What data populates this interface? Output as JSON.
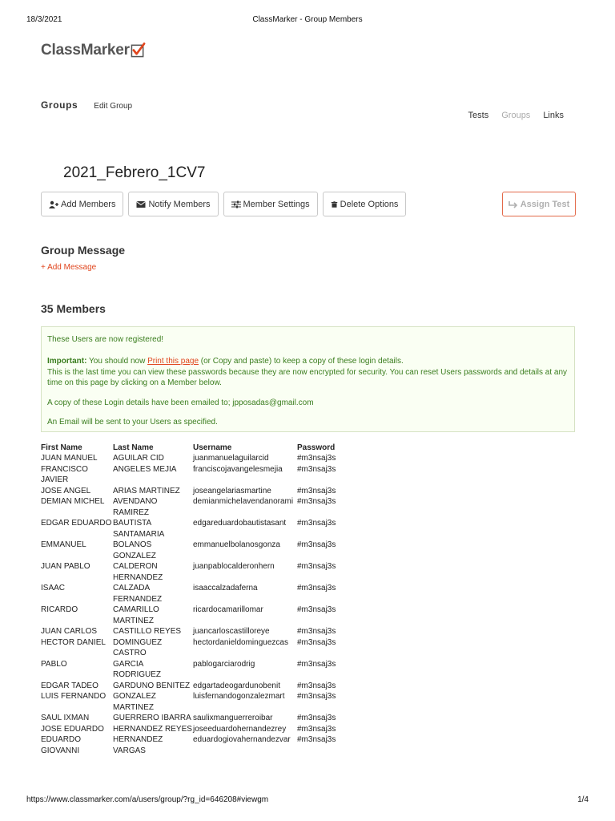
{
  "print_header": {
    "date": "18/3/2021",
    "title": "ClassMarker - Group Members"
  },
  "logo": {
    "text": "ClassMarker",
    "accent": "#e0451d"
  },
  "tabs": {
    "groups": "Groups",
    "edit_group": "Edit Group"
  },
  "topnav": {
    "tests": "Tests",
    "groups": "Groups",
    "links": "Links"
  },
  "group": {
    "title": "2021_Febrero_1CV7"
  },
  "toolbar": {
    "add_members": "Add Members",
    "notify_members": "Notify Members",
    "member_settings": "Member Settings",
    "delete_options": "Delete Options",
    "assign_test": "Assign Test"
  },
  "group_message": {
    "heading": "Group Message",
    "add_message": "+ Add Message"
  },
  "members_section": {
    "heading": "35 Members"
  },
  "notice": {
    "registered": "These Users are now registered!",
    "important_label": "Important:",
    "important_before": " You should now ",
    "print_link": "Print this page",
    "important_after": " (or Copy and paste) to keep a copy of these login details.",
    "last_time": "This is the last time you can view these passwords because they are now encrypted for security. You can reset Users passwords and details at any time on this page by clicking on a Member below.",
    "emailed": "A copy of these Login details have been emailed to; jpposadas@gmail.com",
    "email_sent": "An Email will be sent to your Users as specified."
  },
  "table": {
    "headers": [
      "First Name",
      "Last Name",
      "Username",
      "Password"
    ],
    "rows": [
      [
        "JUAN MANUEL",
        "AGUILAR CID",
        "juanmanuelaguilarcid",
        "#m3nsaj3s"
      ],
      [
        "FRANCISCO JAVIER",
        "ANGELES MEJIA",
        "franciscojavangelesmejia",
        "#m3nsaj3s"
      ],
      [
        "JOSE ANGEL",
        "ARIAS MARTINEZ",
        "joseangelariasmartine",
        "#m3nsaj3s"
      ],
      [
        "DEMIAN MICHEL",
        "AVENDANO RAMIREZ",
        "demianmichelavendanorami",
        "#m3nsaj3s"
      ],
      [
        "EDGAR EDUARDO",
        "BAUTISTA SANTAMARIA",
        "edgareduardobautistasant",
        "#m3nsaj3s"
      ],
      [
        "EMMANUEL",
        "BOLANOS GONZALEZ",
        "emmanuelbolanosgonza",
        "#m3nsaj3s"
      ],
      [
        "JUAN PABLO",
        "CALDERON HERNANDEZ",
        "juanpablocalderonhern",
        "#m3nsaj3s"
      ],
      [
        "ISAAC",
        "CALZADA FERNANDEZ",
        "isaaccalzadaferna",
        "#m3nsaj3s"
      ],
      [
        "RICARDO",
        "CAMARILLO MARTINEZ",
        "ricardocamarillomar",
        "#m3nsaj3s"
      ],
      [
        "JUAN CARLOS",
        "CASTILLO REYES",
        "juancarloscastilloreye",
        "#m3nsaj3s"
      ],
      [
        "HECTOR DANIEL",
        "DOMINGUEZ CASTRO",
        "hectordanieldominguezcas",
        "#m3nsaj3s"
      ],
      [
        "PABLO",
        "GARCIA RODRIGUEZ",
        "pablogarciarodrig",
        "#m3nsaj3s"
      ],
      [
        "EDGAR TADEO",
        "GARDUNO BENITEZ",
        "edgartadeogardunobenit",
        "#m3nsaj3s"
      ],
      [
        "LUIS FERNANDO",
        "GONZALEZ MARTINEZ",
        "luisfernandogonzalezmart",
        "#m3nsaj3s"
      ],
      [
        "SAUL IXMAN",
        "GUERRERO IBARRA",
        "saulixmanguerreroibar",
        "#m3nsaj3s"
      ],
      [
        "JOSE EDUARDO",
        "HERNANDEZ REYES",
        "joseeduardohernandezrey",
        "#m3nsaj3s"
      ],
      [
        "EDUARDO GIOVANNI",
        "HERNANDEZ VARGAS",
        "eduardogiovahernandezvar",
        "#m3nsaj3s"
      ]
    ]
  },
  "print_footer": {
    "url": "https://www.classmarker.com/a/users/group/?rg_id=646208#viewgm",
    "page": "1/4"
  }
}
